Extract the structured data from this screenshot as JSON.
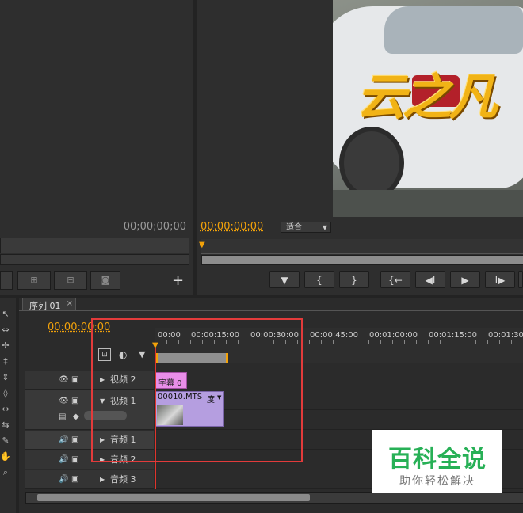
{
  "source_monitor": {
    "timecode": "00;00;00;00"
  },
  "program_monitor": {
    "timecode": "00:00:00:00",
    "fit_dropdown": "适合",
    "overlay_text": "云之凡",
    "transport": [
      "▼",
      "{",
      "}",
      "{←",
      "◀I",
      "▶",
      "I▶"
    ]
  },
  "sequence": {
    "tab_label": "序列 01",
    "tab_close": "×",
    "timecode": "00:00:00:00",
    "ruler_labels": [
      "00:00",
      "00:00:15:00",
      "00:00:30:00",
      "00:00:45:00",
      "00:01:00:00",
      "00:01:15:00",
      "00:01:30"
    ],
    "tracks": [
      {
        "name": "视频 2",
        "kind": "video"
      },
      {
        "name": "视频 1",
        "kind": "video"
      },
      {
        "name": "音频 1",
        "kind": "audio"
      },
      {
        "name": "音频 2",
        "kind": "audio"
      },
      {
        "name": "音频 3",
        "kind": "audio"
      }
    ],
    "clips": {
      "title_clip": "字幕 0",
      "video_clip": "00010.MTS",
      "video_clip_suffix": "度"
    }
  },
  "watermark": {
    "title": "百科全说",
    "subtitle": "助你轻松解决"
  },
  "colors": {
    "timecode": "#f2a20a",
    "highlight_box": "#e23b3b",
    "title_clip": "#e88ee8",
    "video_clip": "#b59ee0",
    "playhead": "#e0342c"
  }
}
